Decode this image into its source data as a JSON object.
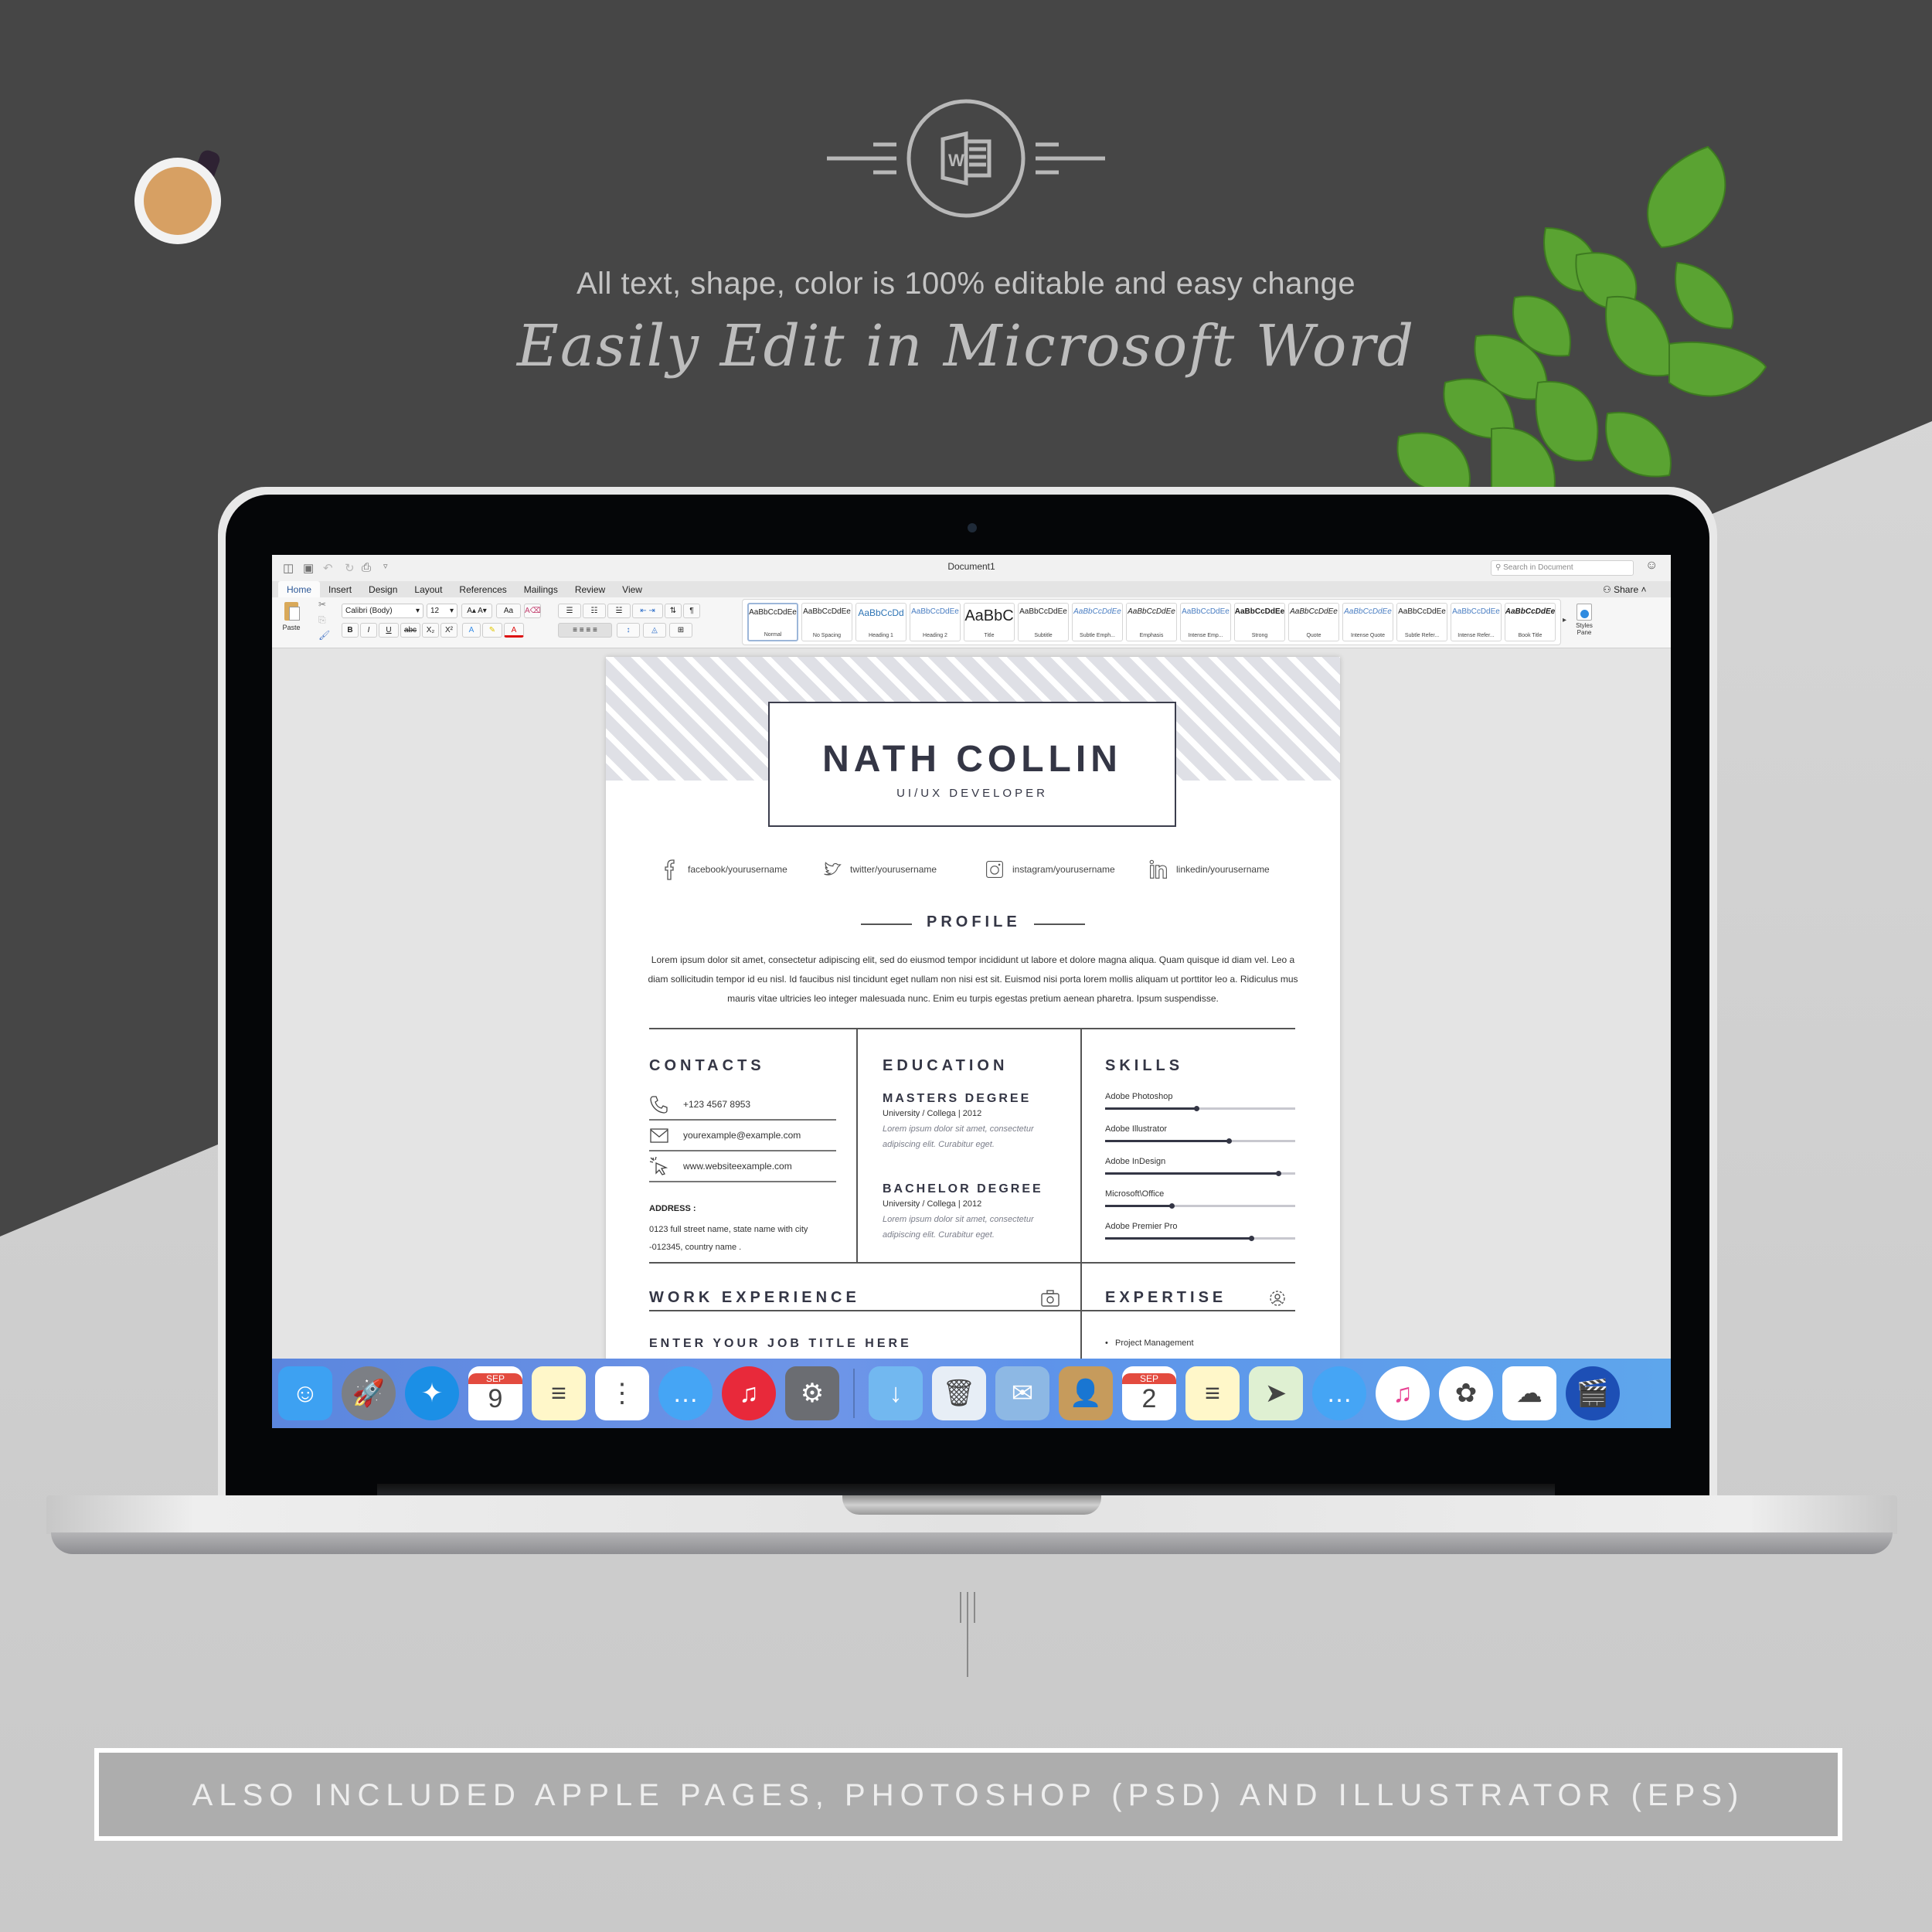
{
  "header": {
    "tagline": "All text, shape, color is 100% editable and easy change",
    "headline": "Easily Edit in Microsoft Word",
    "logo_icon": "word-logo-icon"
  },
  "window": {
    "title": "Document1",
    "search_placeholder": "Search in Document",
    "share_label": "Share",
    "quick_access_icons": [
      "sidebar-icon",
      "save-icon",
      "undo-icon",
      "redo-icon",
      "print-icon",
      "customize-icon"
    ]
  },
  "tabs": [
    {
      "label": "Home",
      "active": true
    },
    {
      "label": "Insert"
    },
    {
      "label": "Design"
    },
    {
      "label": "Layout"
    },
    {
      "label": "References"
    },
    {
      "label": "Mailings"
    },
    {
      "label": "Review"
    },
    {
      "label": "View"
    }
  ],
  "ribbon": {
    "paste_label": "Paste",
    "font_name": "Calibri (Body)",
    "font_size": "12",
    "format_buttons": [
      "B",
      "I",
      "U",
      "abc",
      "X₂",
      "X²"
    ],
    "styles": [
      {
        "sample": "AaBbCcDdEe",
        "name": "Normal",
        "active": true
      },
      {
        "sample": "AaBbCcDdEe",
        "name": "No Spacing"
      },
      {
        "sample": "AaBbCcDd",
        "name": "Heading 1"
      },
      {
        "sample": "AaBbCcDdEe",
        "name": "Heading 2"
      },
      {
        "sample": "AaBbC",
        "name": "Title"
      },
      {
        "sample": "AaBbCcDdEe",
        "name": "Subtitle"
      },
      {
        "sample": "AaBbCcDdEe",
        "name": "Subtle Emph..."
      },
      {
        "sample": "AaBbCcDdEe",
        "name": "Emphasis"
      },
      {
        "sample": "AaBbCcDdEe",
        "name": "Intense Emp..."
      },
      {
        "sample": "AaBbCcDdEe",
        "name": "Strong"
      },
      {
        "sample": "AaBbCcDdEe",
        "name": "Quote"
      },
      {
        "sample": "AaBbCcDdEe",
        "name": "Intense Quote"
      },
      {
        "sample": "AaBbCcDdEe",
        "name": "Subtle Refer..."
      },
      {
        "sample": "AaBbCcDdEe",
        "name": "Intense Refer..."
      },
      {
        "sample": "AaBbCcDdEe",
        "name": "Book Title"
      }
    ],
    "styles_pane_label": "Styles Pane"
  },
  "resume": {
    "name": "NATH COLLIN",
    "role": "UI/UX DEVELOPER",
    "social": [
      {
        "icon": "facebook-icon",
        "text": "facebook/yourusername"
      },
      {
        "icon": "twitter-icon",
        "text": "twitter/yourusername"
      },
      {
        "icon": "instagram-icon",
        "text": "instagram/yourusername"
      },
      {
        "icon": "linkedin-icon",
        "text": "linkedin/yourusername"
      }
    ],
    "profile": {
      "title": "PROFILE",
      "text": "Lorem ipsum dolor sit amet, consectetur adipiscing elit, sed do eiusmod tempor incididunt ut labore et dolore magna aliqua. Quam quisque id diam vel. Leo a diam sollicitudin tempor id eu nisl. Id faucibus nisl tincidunt eget nullam non nisi est sit. Euismod nisi porta lorem mollis aliquam ut porttitor leo a. Ridiculus mus mauris vitae ultricies leo integer malesuada nunc. Enim eu turpis egestas pretium aenean pharetra. Ipsum suspendisse."
    },
    "contacts": {
      "title": "CONTACTS",
      "items": [
        {
          "icon": "phone-icon",
          "text": "+123 4567 8953"
        },
        {
          "icon": "mail-icon",
          "text": "yourexample@example.com"
        },
        {
          "icon": "cursor-click-icon",
          "text": "www.websiteexample.com"
        }
      ],
      "address_label": "ADDRESS :",
      "address": "0123 full street name, state name with city -012345, country name ."
    },
    "education": {
      "title": "EDUCATION",
      "items": [
        {
          "degree": "MASTERS DEGREE",
          "school": "University / Collega | 2012",
          "desc": "Lorem ipsum dolor sit amet, consectetur adipiscing elit. Curabitur eget."
        },
        {
          "degree": "BACHELOR DEGREE",
          "school": "University / Collega | 2012",
          "desc": "Lorem ipsum dolor sit amet, consectetur adipiscing elit. Curabitur eget."
        }
      ]
    },
    "skills": {
      "title": "SKILLS",
      "items": [
        {
          "name": "Adobe Photoshop",
          "level": 0.48
        },
        {
          "name": "Adobe Illustrator",
          "level": 0.65
        },
        {
          "name": "Adobe InDesign",
          "level": 0.91
        },
        {
          "name": "Microsoft\\Office",
          "level": 0.35
        },
        {
          "name": "Adobe Premier Pro",
          "level": 0.77
        }
      ]
    },
    "work": {
      "title": "WORK EXPERIENCE",
      "icon": "briefcase-icon",
      "job_title": "ENTER YOUR JOB TITLE HERE"
    },
    "expertise": {
      "title": "EXPERTISE",
      "icon": "gear-badge-icon",
      "items": [
        "Project Management"
      ]
    }
  },
  "dock": {
    "apps": [
      {
        "name": "finder",
        "color": "#3da1f2",
        "glyph": "☺"
      },
      {
        "name": "launchpad",
        "color": "#7c7f85",
        "glyph": "🚀"
      },
      {
        "name": "safari",
        "color": "#1b8fe6",
        "glyph": "✦"
      },
      {
        "name": "calendar",
        "color": "#ffffff",
        "glyph": "9",
        "month": "SEP"
      },
      {
        "name": "notes",
        "color": "#fff7c9",
        "glyph": "≡"
      },
      {
        "name": "reminders",
        "color": "#ffffff",
        "glyph": "⋮"
      },
      {
        "name": "messages",
        "color": "#45a5f5",
        "glyph": "…"
      },
      {
        "name": "itunes",
        "color": "#e8293a",
        "glyph": "♫"
      },
      {
        "name": "system-preferences",
        "color": "#6b6d72",
        "glyph": "⚙"
      },
      {
        "separator": true
      },
      {
        "name": "downloads",
        "color": "#72b8f0",
        "glyph": "↓"
      },
      {
        "name": "trash",
        "color": "#e7eef6",
        "glyph": "🗑"
      },
      {
        "name": "mail",
        "color": "#8db8e4",
        "glyph": "✉"
      },
      {
        "name": "contacts",
        "color": "#c69b5c",
        "glyph": "👤"
      },
      {
        "name": "calendar",
        "color": "#ffffff",
        "glyph": "2",
        "month": "SEP"
      },
      {
        "name": "notes",
        "color": "#fff7c9",
        "glyph": "≡"
      },
      {
        "name": "maps",
        "color": "#dff0d2",
        "glyph": "➤"
      },
      {
        "name": "messages",
        "color": "#45a5f5",
        "glyph": "…"
      },
      {
        "name": "itunes",
        "color": "#ffffff",
        "glyph": "♫"
      },
      {
        "name": "photos",
        "color": "#ffffff",
        "glyph": "✿"
      },
      {
        "name": "icloud",
        "color": "#ffffff",
        "glyph": "☁"
      },
      {
        "name": "imovie",
        "color": "#1d4fb5",
        "glyph": "🎬"
      }
    ]
  },
  "footer": {
    "banner": "ALSO INCLUDED APPLE PAGES, PHOTOSHOP (PSD) AND ILLUSTRATOR (EPS)"
  }
}
